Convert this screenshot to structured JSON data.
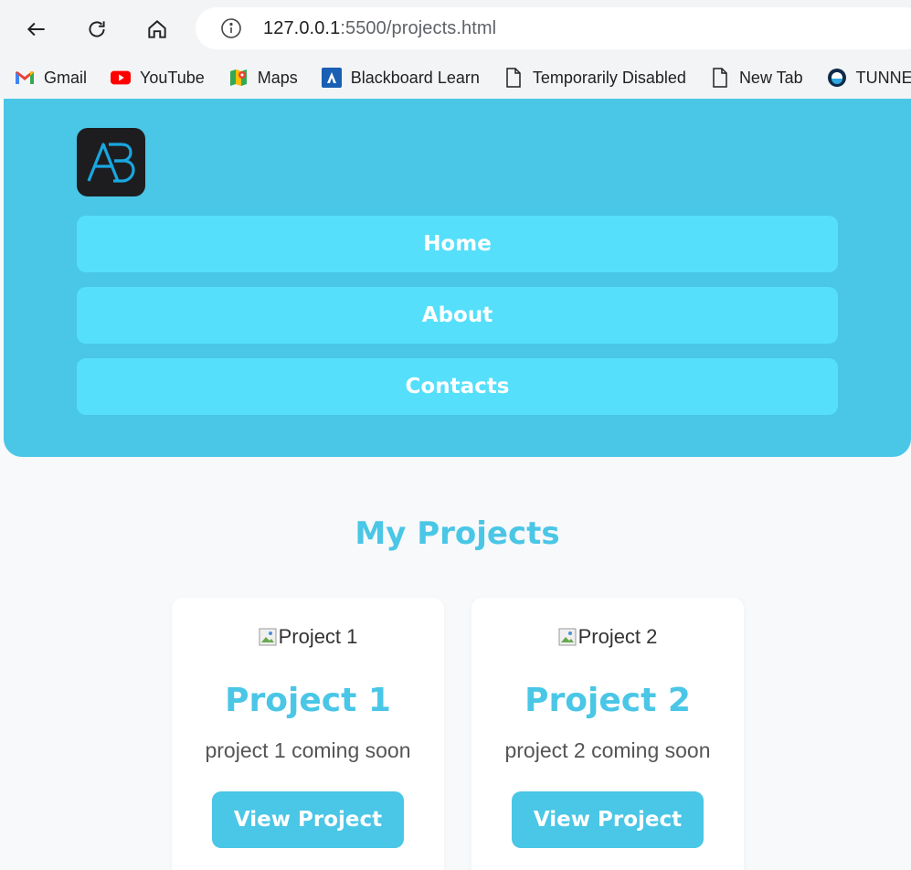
{
  "browser": {
    "url_host": "127.0.0.1",
    "url_rest": ":5500/projects.html",
    "bookmarks": [
      {
        "label": "Gmail",
        "icon": "gmail-icon"
      },
      {
        "label": "YouTube",
        "icon": "youtube-icon"
      },
      {
        "label": "Maps",
        "icon": "maps-icon"
      },
      {
        "label": "Blackboard Learn",
        "icon": "blackboard-icon"
      },
      {
        "label": "Temporarily Disabled",
        "icon": "page-icon"
      },
      {
        "label": "New Tab",
        "icon": "page-icon"
      },
      {
        "label": "TUNNEL",
        "icon": "tunnel-icon"
      }
    ]
  },
  "header": {
    "logo_text": "AB",
    "nav": [
      {
        "label": "Home"
      },
      {
        "label": "About"
      },
      {
        "label": "Contacts"
      }
    ]
  },
  "main": {
    "title": "My Projects",
    "projects": [
      {
        "image_alt": "Project 1",
        "title": "Project 1",
        "description": "project 1 coming soon",
        "button": "View Project"
      },
      {
        "image_alt": "Project 2",
        "title": "Project 2",
        "description": "project 2 coming soon",
        "button": "View Project"
      }
    ]
  },
  "colors": {
    "accent": "#4ac6e6",
    "nav_button": "#55dffb",
    "background": "#f7f9fb"
  }
}
